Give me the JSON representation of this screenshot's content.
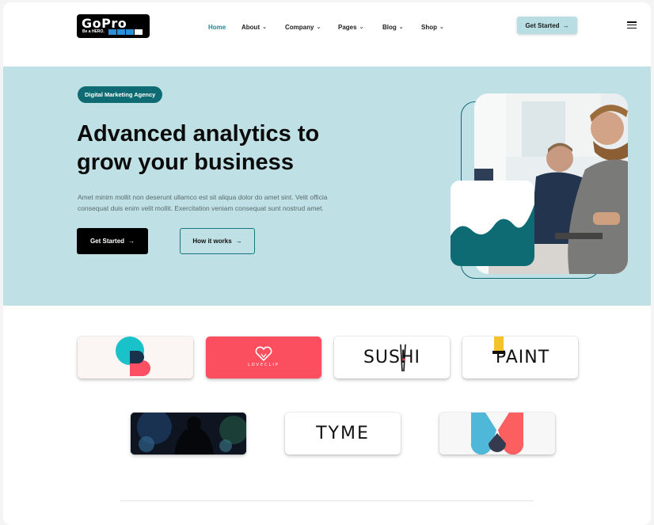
{
  "brand": {
    "name": "GoPro",
    "tagline": "Be a HERO."
  },
  "nav": {
    "items": [
      {
        "label": "Home",
        "active": true
      },
      {
        "label": "About",
        "dropdown": true
      },
      {
        "label": "Company",
        "dropdown": true
      },
      {
        "label": "Pages",
        "dropdown": true
      },
      {
        "label": "Blog",
        "dropdown": true
      },
      {
        "label": "Shop",
        "dropdown": true
      }
    ],
    "cta_label": "Get Started"
  },
  "hero": {
    "badge": "Digital Marketing Agency",
    "title_line1": "Advanced analytics to",
    "title_line2": "grow your business",
    "description": "Amet minim mollit non deserunt ullamco est sit aliqua dolor do amet sint. Velit officia consequat duis enim velit mollit. Exercitation veniam consequat sunt nostrud amet.",
    "primary_button": "Get Started",
    "secondary_button": "How it works"
  },
  "client_logos": [
    {
      "name": "loveclip",
      "text": "LOVECLIP"
    },
    {
      "name": "sushi",
      "text": "SUSHI"
    },
    {
      "name": "paint",
      "text": "PAINT"
    },
    {
      "name": "tyme",
      "text": "TYME"
    }
  ],
  "colors": {
    "accent": "#0e6b73",
    "hero_bg": "#bfe0e4",
    "loveclip_red": "#fb4f5f",
    "header_button": "#b8dde2"
  }
}
